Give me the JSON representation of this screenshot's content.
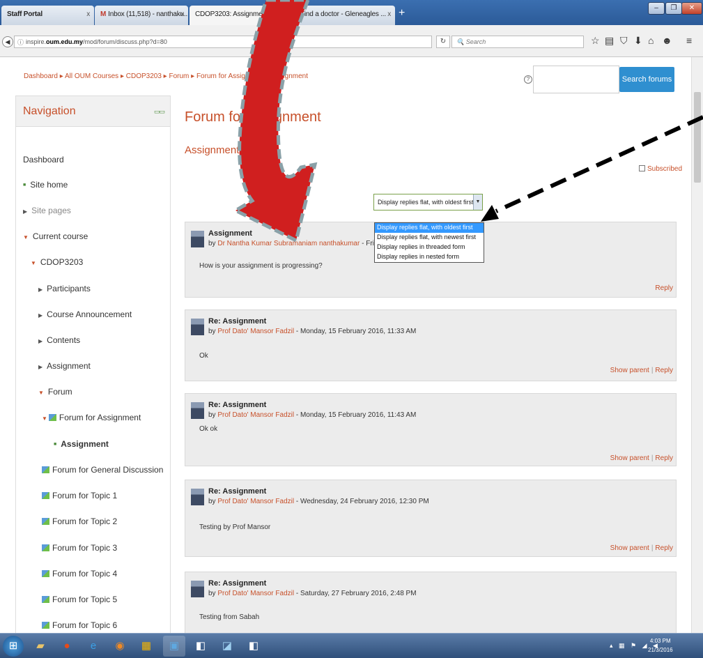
{
  "browser": {
    "tabs": [
      {
        "label": "Staff Portal"
      },
      {
        "label": "Inbox (11,518) - nanthaku..."
      },
      {
        "label": "CDOP3203: Assignment"
      },
      {
        "label": "Find a doctor - Gleneagles ..."
      }
    ],
    "url_prefix": "inspire.",
    "url_domain": "oum.edu.my",
    "url_path": "/mod/forum/discuss.php?d=80",
    "search_placeholder": "Search"
  },
  "breadcrumb": "Dashboard ▸ All OUM Courses ▸ CDOP3203 ▸ Forum ▸ Forum for Assignment ▸ Assignment",
  "search_forums_label": "Search forums",
  "navigation": {
    "title": "Navigation",
    "items": {
      "dashboard": "Dashboard",
      "site_home": "Site home",
      "site_pages": "Site pages",
      "current_course": "Current course",
      "course": "CDOP3203",
      "participants": "Participants",
      "announcement": "Course Announcement",
      "contents": "Contents",
      "assignment": "Assignment",
      "forum": "Forum",
      "forum_assignment": "Forum for Assignment",
      "assignment_current": "Assignment",
      "forum_general": "Forum for General Discussion",
      "topic1": "Forum for Topic 1",
      "topic2": "Forum for Topic 2",
      "topic3": "Forum for Topic 3",
      "topic4": "Forum for Topic 4",
      "topic5": "Forum for Topic 5",
      "topic6": "Forum for Topic 6"
    }
  },
  "main": {
    "title": "Forum for Assignment",
    "subtitle": "Assignment",
    "subscribed": "Subscribed",
    "display_mode": {
      "selected": "Display replies flat, with oldest first",
      "options": [
        "Display replies flat, with oldest first",
        "Display replies flat, with newest first",
        "Display replies in threaded form",
        "Display replies in nested form"
      ]
    },
    "posts": [
      {
        "title": "Assignment",
        "by": "by",
        "author": "Dr Nantha Kumar Subramaniam nanthakumar",
        "date": " - Friday, 5 February 2016",
        "message": "How is your assignment is progressing?",
        "reply": "Reply"
      },
      {
        "title": "Re: Assignment",
        "by": "by",
        "author": "Prof Dato' Mansor Fadzil",
        "date": " - Monday, 15 February 2016, 11:33 AM",
        "message": "Ok",
        "show_parent": "Show parent",
        "reply": "Reply"
      },
      {
        "title": "Re: Assignment",
        "by": "by",
        "author": "Prof Dato' Mansor Fadzil",
        "date": " - Monday, 15 February 2016, 11:43 AM",
        "message": "Ok ok",
        "show_parent": "Show parent",
        "reply": "Reply"
      },
      {
        "title": "Re: Assignment",
        "by": "by",
        "author": "Prof Dato' Mansor Fadzil",
        "date": " - Wednesday, 24 February 2016, 12:30 PM",
        "message": "Testing by Prof Mansor",
        "show_parent": "Show parent",
        "reply": "Reply"
      },
      {
        "title": "Re: Assignment",
        "by": "by",
        "author": "Prof Dato' Mansor Fadzil",
        "date": " - Saturday, 27 February 2016, 2:48 PM",
        "message": "Testing from Sabah"
      }
    ]
  },
  "taskbar": {
    "time": "4:03 PM",
    "date": "21/3/2016"
  },
  "colors": {
    "accent": "#c7502a",
    "button": "#2f8fd0",
    "annotation_arrow": "#d01f1f"
  }
}
